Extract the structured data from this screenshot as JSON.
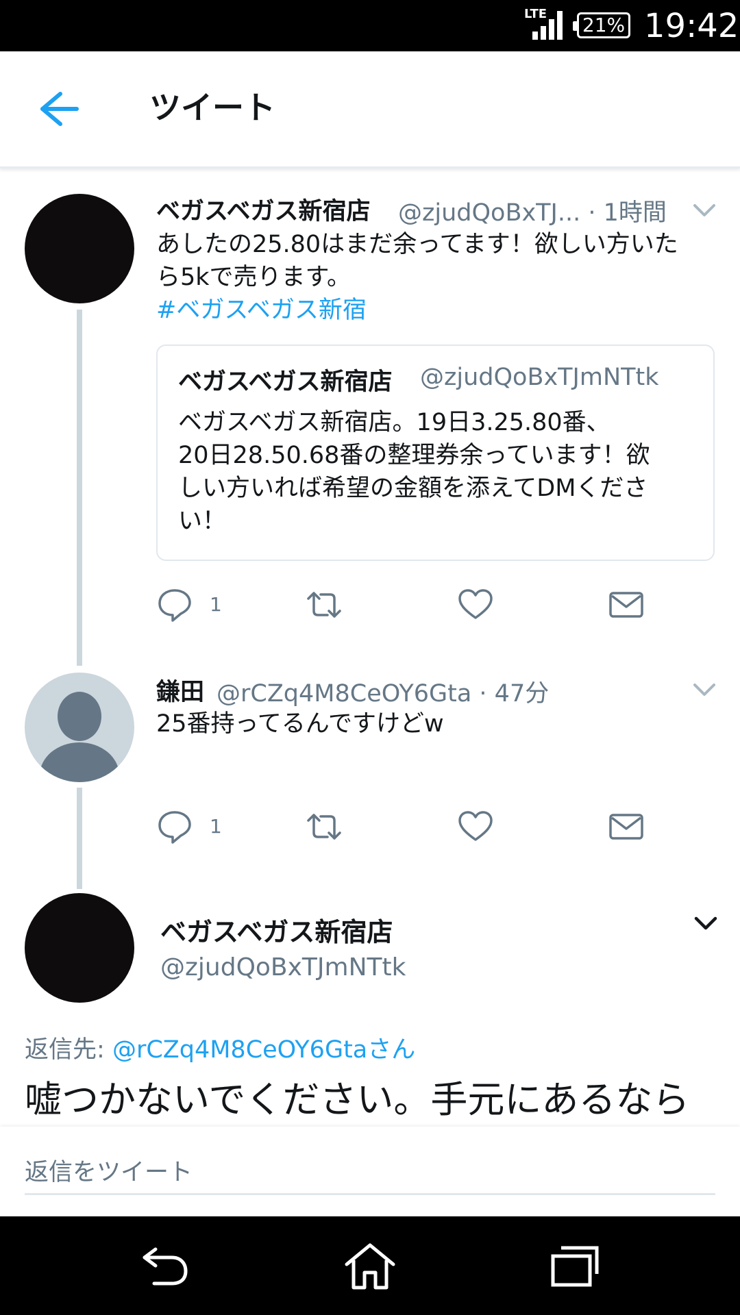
{
  "status_bar": {
    "network": "LTE",
    "battery": "21%",
    "time": "19:42"
  },
  "header": {
    "title": "ツイート"
  },
  "tweets": [
    {
      "name": "ベガスベガス新宿店",
      "handle_time": "@zjudQoBxTJ... · 1時間",
      "text_line1": "あしたの25.80はまだ余ってます！欲しい方いた",
      "text_line2": "ら5kで売ります。",
      "hashtag": "#ベガスベガス新宿",
      "quote": {
        "name": "ベガスベガス新宿店",
        "handle": "@zjudQoBxTJmNTtk",
        "line1": "ベガスベガス新宿店。19日3.25.80番、",
        "line2": "20日28.50.68番の整理券余っています！欲",
        "line3": "しい方いれば希望の金額を添えてDMくださ",
        "line4": "い！"
      },
      "reply_count": "1"
    },
    {
      "name": "鎌田",
      "handle_time": "@rCZq4M8CeOY6Gta · 47分",
      "text_line1": "25番持ってるんですけどw",
      "reply_count": "1"
    },
    {
      "name": "ベガスベガス新宿店",
      "handle": "@zjudQoBxTJmNTtk",
      "reply_to_label": "返信先:",
      "reply_to_user": "@rCZq4M8CeOY6Gtaさん",
      "text": "嘘つかないでください。手元にあるなら"
    }
  ],
  "reply_bar": {
    "placeholder": "返信をツイート"
  },
  "colors": {
    "accent": "#1da1f2",
    "muted": "#657786",
    "thread": "#ccd6dd"
  },
  "icons": [
    "back-arrow-icon",
    "reply-icon",
    "retweet-icon",
    "like-icon",
    "dm-icon",
    "chevron-down-icon",
    "nav-back-icon",
    "nav-home-icon",
    "nav-recents-icon"
  ]
}
